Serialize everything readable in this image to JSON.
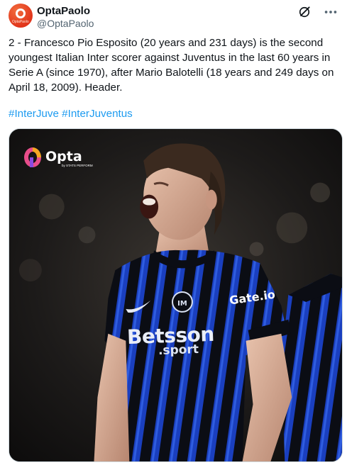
{
  "author": {
    "display_name": "OptaPaolo",
    "handle": "@OptaPaolo",
    "avatar_label": "OptaPaolo"
  },
  "header_icons": {
    "grok": "grok-icon",
    "more": "more-icon"
  },
  "tweet": {
    "text": "2 - Francesco Pio Esposito (20 years and 231 days) is the second youngest Italian Inter scorer against Juventus in the last 60 years in Serie A (since 1970), after Mario Balotelli (18 years and 249 days on April 18, 2009). Header.",
    "hashtags": [
      "#InterJuve",
      "#InterJuventus"
    ]
  },
  "media": {
    "logo_word": "Opta",
    "logo_sub": "by STATS PERFORM",
    "shirt_sponsor": "Betsson",
    "shirt_sponsor_sub": ".sport",
    "sleeve_sponsor": "Gate.io"
  },
  "colors": {
    "accent": "#1d9bf0",
    "text": "#0f1419",
    "muted": "#536471",
    "avatar": "#e1351b",
    "kit_blue": "#1a3fbf",
    "kit_black": "#0b0d14"
  }
}
